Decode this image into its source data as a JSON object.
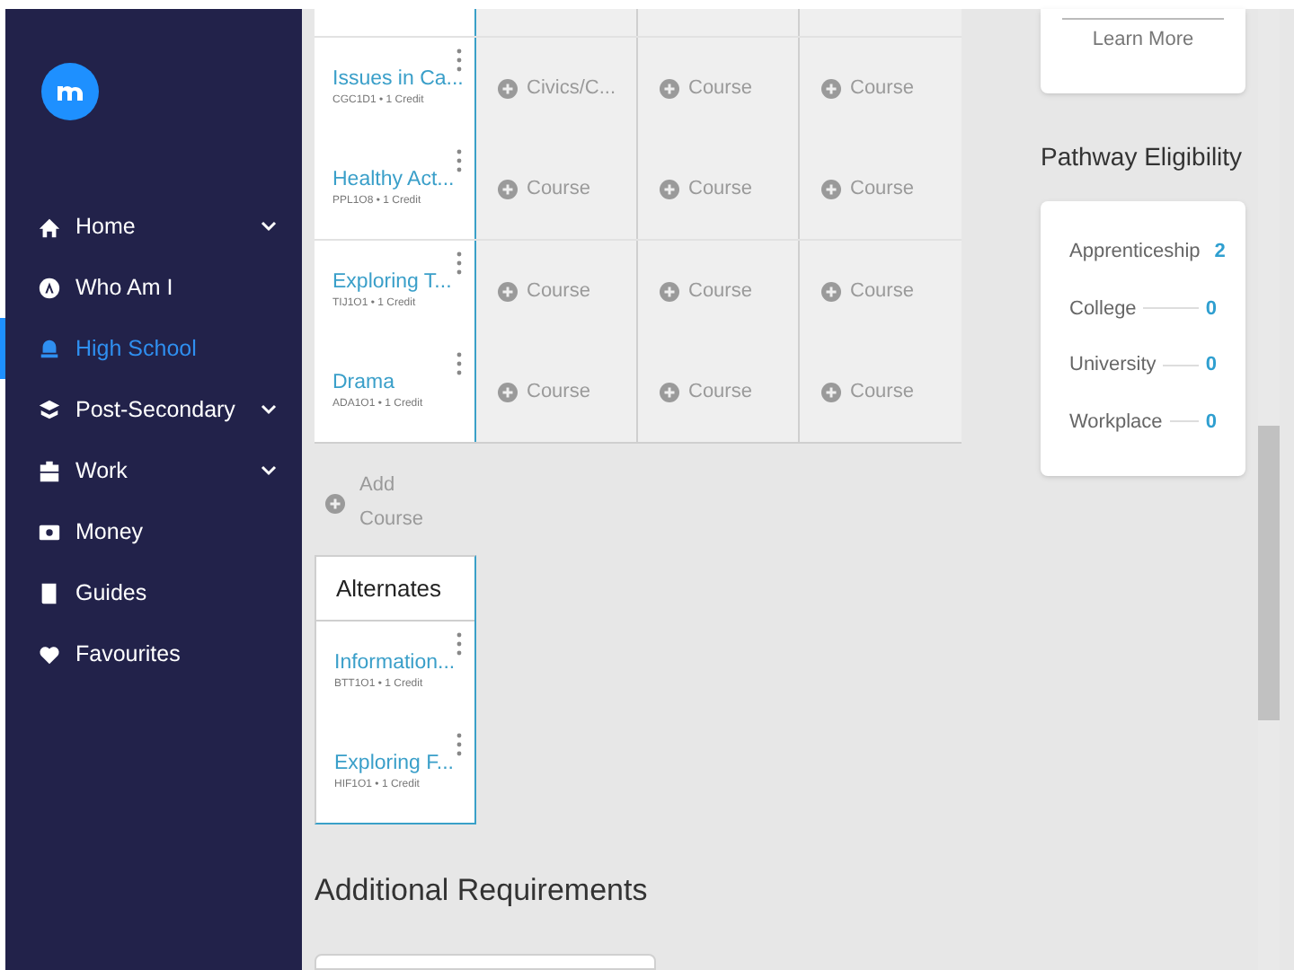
{
  "sidebar": {
    "items": [
      {
        "label": "Home",
        "kind": "home",
        "selected": false,
        "has_submenu": true
      },
      {
        "label": "Who Am I",
        "kind": "compass",
        "selected": false,
        "has_submenu": false
      },
      {
        "label": "High School",
        "kind": "bell",
        "selected": true,
        "has_submenu": false
      },
      {
        "label": "Post-Secondary",
        "kind": "grad",
        "selected": false,
        "has_submenu": true
      },
      {
        "label": "Work",
        "kind": "briefcase",
        "selected": false,
        "has_submenu": true
      },
      {
        "label": "Money",
        "kind": "money",
        "selected": false,
        "has_submenu": false
      },
      {
        "label": "Guides",
        "kind": "book",
        "selected": false,
        "has_submenu": false
      },
      {
        "label": "Favourites",
        "kind": "heart",
        "selected": false,
        "has_submenu": false
      }
    ]
  },
  "plan": {
    "rows": [
      {
        "course": {
          "title": "Issues in Ca...",
          "code": "CGC1D1 • 1 Credit"
        },
        "slots": [
          "Civics/C...",
          "Course",
          "Course"
        ]
      },
      {
        "course": {
          "title": "Healthy Act...",
          "code": "PPL1O8 • 1 Credit"
        },
        "slots": [
          "Course",
          "Course",
          "Course"
        ]
      },
      {
        "course": {
          "title": "Exploring T...",
          "code": "TIJ1O1 • 1 Credit"
        },
        "slots": [
          "Course",
          "Course",
          "Course"
        ]
      },
      {
        "course": {
          "title": "Drama",
          "code": "ADA1O1 • 1 Credit"
        },
        "slots": [
          "Course",
          "Course",
          "Course"
        ]
      }
    ],
    "add_course": "Add Course"
  },
  "alternates": {
    "title": "Alternates",
    "courses": [
      {
        "title": "Information...",
        "code": "BTT1O1 • 1 Credit"
      },
      {
        "title": "Exploring F...",
        "code": "HIF1O1 • 1 Credit"
      }
    ]
  },
  "additional_requirements": {
    "title": "Additional Requirements"
  },
  "learn_more": "Learn More",
  "pathway_eligibility": {
    "title": "Pathway Eligibility",
    "rows": [
      {
        "label": "Apprenticeship",
        "count": "2"
      },
      {
        "label": "College",
        "count": "0"
      },
      {
        "label": "University",
        "count": "0"
      },
      {
        "label": "Workplace",
        "count": "0"
      }
    ]
  }
}
